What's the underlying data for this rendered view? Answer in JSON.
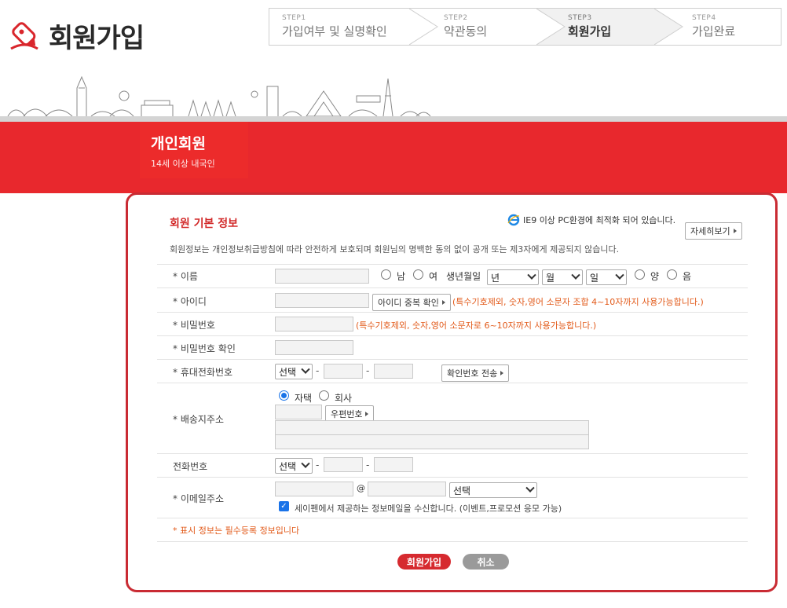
{
  "header": {
    "title": "회원가입",
    "steps": [
      {
        "num": "STEP1",
        "label": "가입여부 및 실명확인"
      },
      {
        "num": "STEP2",
        "label": "약관동의"
      },
      {
        "num": "STEP3",
        "label": "회원가입"
      },
      {
        "num": "STEP4",
        "label": "가입완료"
      }
    ],
    "active_step": 3,
    "accent": "#e8282d"
  },
  "banner": {
    "title": "개인회원",
    "subtitle": "14세 이상 내국인"
  },
  "form": {
    "section_title": "회원 기본 정보",
    "ie_note": "IE9 이상 PC환경에 최적화 되어 있습니다.",
    "detail_button": "자세히보기",
    "intro": "회원정보는 개인정보취급방침에 따라 안전하게 보호되며 회원님의 명백한 동의 없이 공개 또는 제3자에게 제공되지 않습니다.",
    "name": {
      "label": "* 이름",
      "gender_male": "남",
      "gender_female": "여",
      "birth_label": "생년월일",
      "year": "년",
      "month": "월",
      "day": "일",
      "solar": "양",
      "lunar": "음"
    },
    "user_id": {
      "label": "* 아이디",
      "check_button": "아이디 중복 확인",
      "hint": "(특수기호제외, 숫자,영어 소문자 조합 4~10자까지 사용가능합니다.)"
    },
    "password": {
      "label": "* 비밀번호",
      "hint": "(특수기호제외, 숫자,영어 소문자로 6~10자까지 사용가능합니다.)"
    },
    "password_confirm": {
      "label": "* 비밀번호 확인"
    },
    "mobile": {
      "label": "* 휴대전화번호",
      "select": "선택",
      "dash": "-",
      "send_button": "확인번호 전송"
    },
    "address": {
      "label": "* 배송지주소",
      "home": "자택",
      "company": "회사",
      "home_selected": true,
      "zip_button": "우편번호"
    },
    "phone": {
      "label": "전화번호",
      "select": "선택",
      "dash": "-"
    },
    "email": {
      "label": "* 이메일주소",
      "at": "@",
      "domain_select": "선택",
      "consent_checked": true,
      "consent": "세이펜에서 제공하는 정보메일을 수신합니다. (이벤트,프로모션 응모 가능)"
    },
    "required_note": "* 표시 정보는 필수등록 정보입니다",
    "submit_button": "회원가입",
    "cancel_button": "취소"
  }
}
